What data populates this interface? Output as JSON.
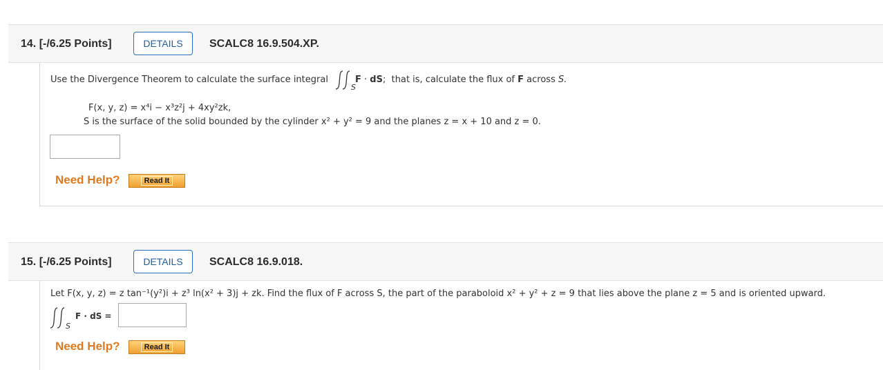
{
  "questions": [
    {
      "number_label": "14.",
      "points_label": "[-/6.25 Points]",
      "details_label": "DETAILS",
      "code": "SCALC8 16.9.504.XP.",
      "prompt_before_integral": "Use the Divergence Theorem to calculate the surface integral",
      "integral_subscript": "S",
      "prompt_after_integral_F": "F",
      "prompt_after_integral_dS": "dS;",
      "prompt_after_integral_rest": "that is, calculate the flux of",
      "prompt_after_F2": "F",
      "prompt_after_across": "across",
      "prompt_S": "S.",
      "field_line": "F(x, y, z) = x⁴i − x³z²j + 4xy²zk,",
      "surface_line": "S is the surface of the solid bounded by the cylinder  x² + y² = 9  and the planes  z = x + 10 and z = 0.",
      "answer_value": "",
      "need_help_label": "Need Help?",
      "read_it_label": "Read It"
    },
    {
      "number_label": "15.",
      "points_label": "[-/6.25 Points]",
      "details_label": "DETAILS",
      "code": "SCALC8 16.9.018.",
      "prompt_line": "Let  F(x, y, z) = z tan⁻¹(y²)i + z³ ln(x² + 3)j + zk.  Find the flux of F across S, the part of the paraboloid  x² + y² + z = 9  that lies above the plane  z = 5  and is oriented upward.",
      "integral_subscript": "S",
      "integral_label": "F · dS =",
      "answer_value": "",
      "need_help_label": "Need Help?",
      "read_it_label": "Read It"
    }
  ]
}
